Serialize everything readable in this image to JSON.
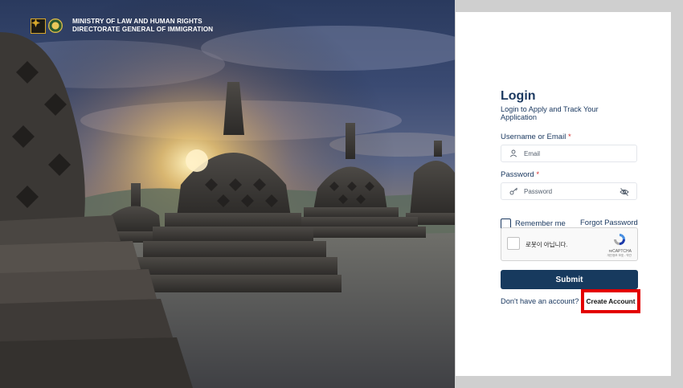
{
  "header": {
    "ministry_line1": "MINISTRY OF LAW AND HUMAN RIGHTS",
    "ministry_line2": "DIRECTORATE GENERAL OF IMMIGRATION"
  },
  "login": {
    "title": "Login",
    "subtitle": "Login to Apply and Track Your Application",
    "username_label": "Username or Email",
    "required_mark": "*",
    "email_placeholder": "Email",
    "password_label": "Password",
    "password_placeholder": "Password",
    "remember_label": "Remember me",
    "forgot_label": "Forgot Password",
    "recaptcha_text": "로봇이 아닙니다.",
    "recaptcha_brand": "reCAPTCHA",
    "recaptcha_terms": "개인정보 보호 - 약관",
    "submit_label": "Submit",
    "no_account_text": "Don't have an account?",
    "create_account_label": "Create Account"
  },
  "icons": {
    "email_field": "user-icon",
    "password_field": "key-icon",
    "password_toggle": "eye-off-icon",
    "recaptcha": "recaptcha-logo-icon"
  },
  "colors": {
    "primary": "#173a5e",
    "heading": "#1c3a61",
    "required": "#d62f2f",
    "highlight": "#e30000"
  }
}
